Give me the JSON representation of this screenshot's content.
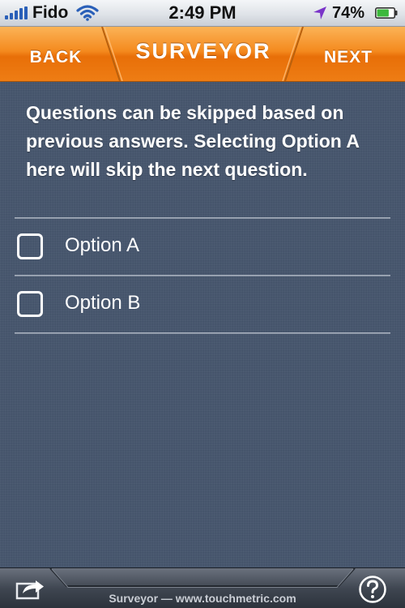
{
  "status_bar": {
    "carrier": "Fido",
    "time": "2:49 PM",
    "battery_percent": "74%",
    "icons": [
      "signal-bars-icon",
      "wifi-icon",
      "location-arrow-icon",
      "battery-icon"
    ],
    "battery_level": 0.74
  },
  "nav_bar": {
    "back_label": "BACK",
    "title": "SURVEYOR",
    "next_label": "NEXT",
    "accent_color": "#f17e15"
  },
  "question": {
    "text": "Questions can be skipped based on previous answers. Selecting Option A here will skip the next question."
  },
  "options": [
    {
      "label": "Option A",
      "checked": false
    },
    {
      "label": "Option B",
      "checked": false
    }
  ],
  "toolbar": {
    "footer_text": "Surveyor — www.touchmetric.com",
    "share_icon": "share-icon",
    "help_icon": "help-icon"
  },
  "colors": {
    "background": "#45546c",
    "text": "#ffffff"
  }
}
